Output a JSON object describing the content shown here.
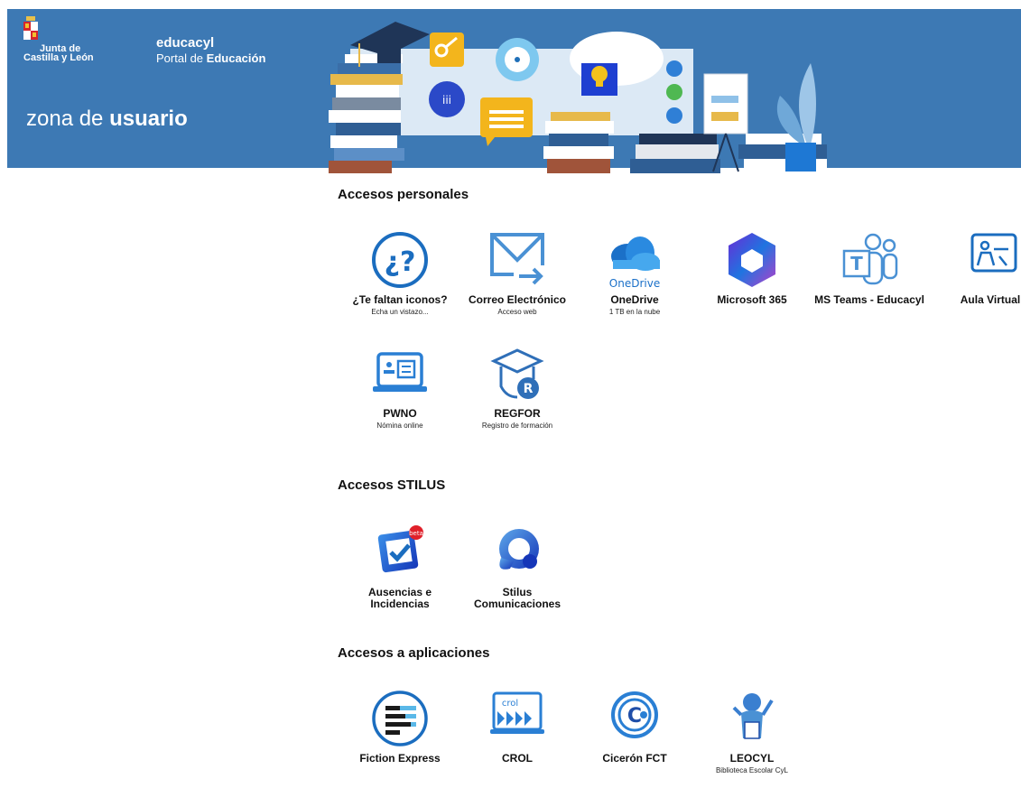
{
  "header": {
    "junta_line1": "Junta de",
    "junta_line2": "Castilla y León",
    "brand": "educacyl",
    "portal_prefix": "Portal de ",
    "portal_bold": "Educación",
    "zona_prefix": "zona de ",
    "zona_bold": "usuario",
    "bg_color": "#3d79b4"
  },
  "sections": {
    "personales": {
      "title": "Accesos personales",
      "tiles": [
        {
          "label": "¿Te faltan iconos?",
          "sub": "Echa un vistazo...",
          "icon": "question-icon"
        },
        {
          "label": "Correo Electrónico",
          "sub": "Acceso web",
          "icon": "mail-icon"
        },
        {
          "label": "OneDrive",
          "sub": "1 TB en la nube",
          "icon": "onedrive-icon",
          "icon_text": "OneDrive"
        },
        {
          "label": "Microsoft 365",
          "sub": "",
          "icon": "microsoft365-icon"
        },
        {
          "label": "MS Teams - Educacyl",
          "sub": "",
          "icon": "teams-icon"
        },
        {
          "label": "Aula Virtual",
          "sub": "",
          "icon": "aula-virtual-icon"
        },
        {
          "label": "PWNO",
          "sub": "Nómina online",
          "icon": "pwno-icon"
        },
        {
          "label": "REGFOR",
          "sub": "Registro de formación",
          "icon": "regfor-icon"
        }
      ]
    },
    "stilus": {
      "title": "Accesos STILUS",
      "tiles": [
        {
          "label": "Ausencias e",
          "label2": "Incidencias",
          "icon": "ausencias-icon",
          "badge": "beta"
        },
        {
          "label": "Stilus",
          "label2": "Comunicaciones",
          "icon": "stilus-comunicaciones-icon"
        }
      ]
    },
    "aplicaciones": {
      "title": "Accesos a aplicaciones",
      "tiles": [
        {
          "label": "Fiction Express",
          "sub": "",
          "icon": "fiction-express-icon"
        },
        {
          "label": "CROL",
          "sub": "",
          "icon": "crol-icon",
          "icon_text": "crol"
        },
        {
          "label": "Cicerón FCT",
          "sub": "",
          "icon": "ciceron-icon"
        },
        {
          "label": "LEOCYL",
          "sub": "Biblioteca Escolar CyL",
          "icon": "leocyl-icon"
        }
      ]
    }
  }
}
